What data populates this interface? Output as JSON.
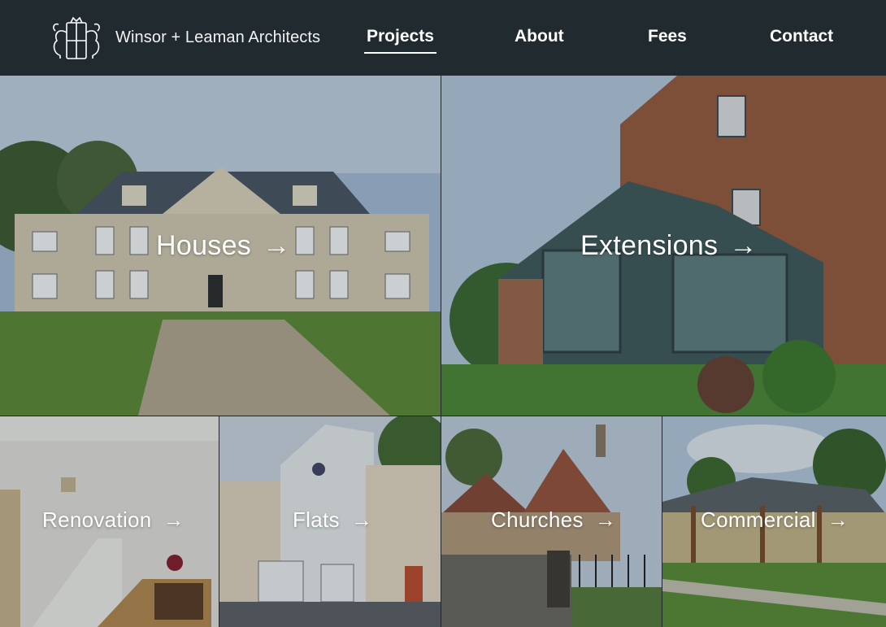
{
  "header": {
    "brand": "Winsor + Leaman Architects",
    "logo_icon": "heraldic-crest-icon",
    "nav": [
      {
        "label": "Projects",
        "active": true
      },
      {
        "label": "About",
        "active": false
      },
      {
        "label": "Fees",
        "active": false
      },
      {
        "label": "Contact",
        "active": false
      }
    ]
  },
  "tiles": [
    {
      "label": "Houses",
      "arrow": "→"
    },
    {
      "label": "Extensions",
      "arrow": "→"
    },
    {
      "label": "Renovation",
      "arrow": "→"
    },
    {
      "label": "Flats",
      "arrow": "→"
    },
    {
      "label": "Churches",
      "arrow": "→"
    },
    {
      "label": "Commercial",
      "arrow": "→"
    }
  ],
  "colors": {
    "header_bg": "#212a2e",
    "text": "#ffffff"
  }
}
